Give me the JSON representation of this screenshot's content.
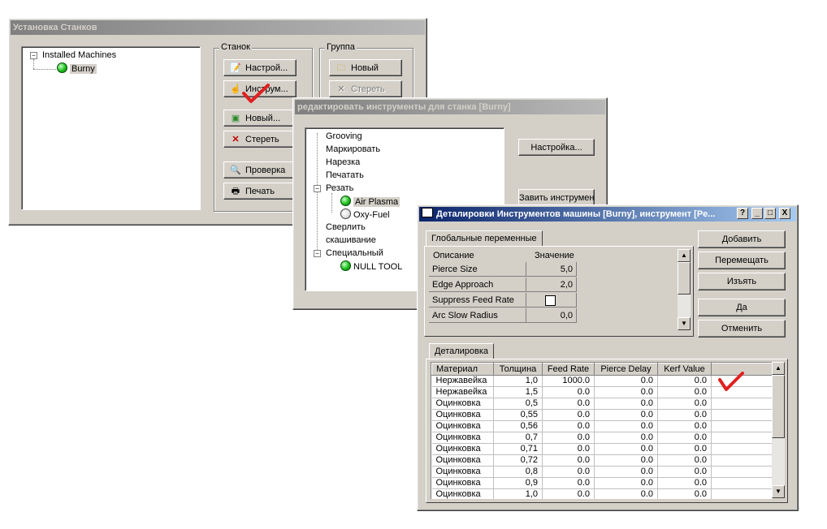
{
  "colors": {
    "checkmark": "#e02020",
    "active_title": "#0a246a",
    "inactive_title": "#808080",
    "led_on": "#18c018"
  },
  "win1": {
    "title": "Установка Станков",
    "tree_root": "Installed Machines",
    "tree_child": "Burny",
    "stanok_group_label": "Станок",
    "gruppa_group_label": "Группа",
    "buttons": {
      "nastroi": "Настрой...",
      "instrum": "Инструм...",
      "novyi": "Новый...",
      "steret": "Стереть",
      "proverka": "Проверка",
      "pechat": "Печать",
      "group_novyi": "Новый",
      "group_steret": "Стереть"
    }
  },
  "win2": {
    "title": "редактировать инструменты для станка [Burny]",
    "tree": [
      "Grooving",
      "Маркировать",
      "Нарезка",
      "Печатать",
      "Резать",
      "Air Plasma",
      "Oxy-Fuel",
      "Сверлить",
      "скашивание",
      "Специальный",
      "NULL TOOL"
    ],
    "buttons": {
      "nastroika": "Настройка...",
      "zavit": "Завить инструмен"
    }
  },
  "win3": {
    "title": "Деталировки Инструментов машины [Burny], инструмент [Pe...",
    "caption_buttons": {
      "help": "?",
      "min": "_",
      "max": "□",
      "close": "X"
    },
    "globals_tab": "Глобальные переменные",
    "globals_headers": {
      "desc": "Описание",
      "value": "Значение"
    },
    "globals": [
      {
        "desc": "Pierce Size",
        "value": "5,0"
      },
      {
        "desc": "Edge Approach",
        "value": "2,0"
      },
      {
        "desc": "Suppress Feed Rate",
        "value": ""
      },
      {
        "desc": "Arc Slow Radius",
        "value": "0,0"
      }
    ],
    "side_buttons": {
      "add": "Добавить",
      "move": "Перемещать",
      "remove": "Изъять",
      "ok": "Да",
      "cancel": "Отменить"
    },
    "detail_tab": "Деталировка",
    "detail_headers": [
      "Материал",
      "Толщина",
      "Feed Rate",
      "Pierce Delay",
      "Kerf Value"
    ],
    "detail_rows": [
      [
        "Нержавейка",
        "1,0",
        "1000.0",
        "0.0",
        "0.0"
      ],
      [
        "Нержавейка",
        "1,5",
        "0.0",
        "0.0",
        "0.0"
      ],
      [
        "Оцинковка",
        "0,5",
        "0.0",
        "0.0",
        "0.0"
      ],
      [
        "Оцинковка",
        "0,55",
        "0.0",
        "0.0",
        "0.0"
      ],
      [
        "Оцинковка",
        "0,56",
        "0.0",
        "0.0",
        "0.0"
      ],
      [
        "Оцинковка",
        "0,7",
        "0.0",
        "0.0",
        "0.0"
      ],
      [
        "Оцинковка",
        "0,71",
        "0.0",
        "0.0",
        "0.0"
      ],
      [
        "Оцинковка",
        "0,72",
        "0.0",
        "0.0",
        "0.0"
      ],
      [
        "Оцинковка",
        "0,8",
        "0.0",
        "0.0",
        "0.0"
      ],
      [
        "Оцинковка",
        "0,9",
        "0.0",
        "0.0",
        "0.0"
      ],
      [
        "Оцинковка",
        "1,0",
        "0.0",
        "0.0",
        "0.0"
      ]
    ]
  }
}
